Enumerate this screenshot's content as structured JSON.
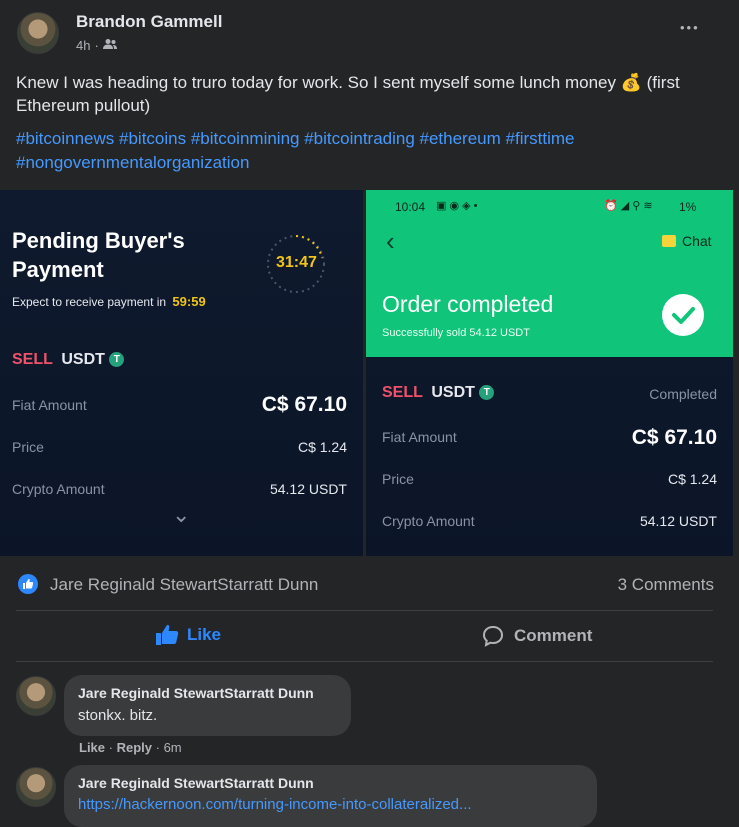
{
  "post": {
    "author": "Brandon Gammell",
    "time": "4h",
    "audience_icon": "friends-icon",
    "text": "Knew I was heading to truro today for work. So I sent myself some lunch money 💰 (first Ethereum pullout)",
    "hashtags_line1": "#bitcoinnews #bitcoins #bitcoinmining #bitcointrading #ethereum #firsttime",
    "hashtags_line2": "#nongovernmentalorganization",
    "more_label": "•••"
  },
  "left_shot": {
    "title_line1": "Pending Buyer's",
    "title_line2": "Payment",
    "timer": "31:47",
    "expect_text": "Expect to receive payment in",
    "expect_time": "59:59",
    "sell": "SELL",
    "coin": "USDT",
    "coin_badge": "T",
    "fiat_label": "Fiat Amount",
    "fiat_value": "C$ 67.10",
    "price_label": "Price",
    "price_value": "C$ 1.24",
    "crypto_label": "Crypto Amount",
    "crypto_value": "54.12 USDT",
    "chevron": "⌄"
  },
  "right_shot": {
    "status_time": "10:04",
    "status_right": "1%",
    "back": "‹",
    "chat_label": "Chat",
    "order_title": "Order completed",
    "order_sub": "Successfully sold  54.12 USDT",
    "sell": "SELL",
    "coin": "USDT",
    "coin_badge": "T",
    "completed": "Completed",
    "fiat_label": "Fiat Amount",
    "fiat_value": "C$ 67.10",
    "price_label": "Price",
    "price_value": "C$ 1.24",
    "crypto_label": "Crypto Amount",
    "crypto_value": "54.12 USDT"
  },
  "reactions": {
    "liker": "Jare Reginald StewartStarratt Dunn",
    "comments_count": "3 Comments"
  },
  "actions": {
    "like": "Like",
    "comment": "Comment"
  },
  "comments": [
    {
      "name": "Jare Reginald StewartStarratt Dunn",
      "text": "stonkx. bitz.",
      "like": "Like",
      "reply": "Reply",
      "time": "6m"
    },
    {
      "name": "Jare Reginald StewartStarratt Dunn",
      "link": "https://hackernoon.com/turning-income-into-collateralized..."
    }
  ],
  "colors": {
    "link": "#4599ff",
    "green_panel": "#10c47a",
    "sell_red": "#f0526a",
    "timer_yellow": "#f0c419"
  }
}
